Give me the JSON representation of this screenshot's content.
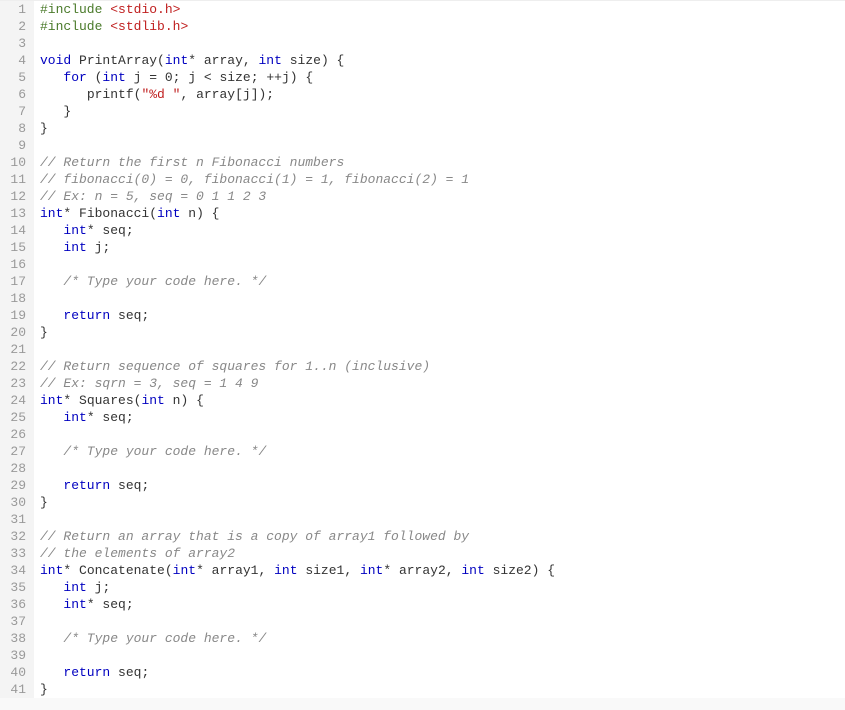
{
  "code_lines": [
    {
      "n": 1,
      "tokens": [
        {
          "c": "pp",
          "t": "#include"
        },
        {
          "c": "pn",
          "t": " "
        },
        {
          "c": "str",
          "t": "<stdio.h>"
        }
      ]
    },
    {
      "n": 2,
      "tokens": [
        {
          "c": "pp",
          "t": "#include"
        },
        {
          "c": "pn",
          "t": " "
        },
        {
          "c": "str",
          "t": "<stdlib.h>"
        }
      ]
    },
    {
      "n": 3,
      "tokens": []
    },
    {
      "n": 4,
      "tokens": [
        {
          "c": "ty",
          "t": "void"
        },
        {
          "c": "pn",
          "t": " "
        },
        {
          "c": "fn",
          "t": "PrintArray"
        },
        {
          "c": "pn",
          "t": "("
        },
        {
          "c": "ty",
          "t": "int"
        },
        {
          "c": "pn",
          "t": "* "
        },
        {
          "c": "id",
          "t": "array"
        },
        {
          "c": "pn",
          "t": ", "
        },
        {
          "c": "ty",
          "t": "int"
        },
        {
          "c": "pn",
          "t": " "
        },
        {
          "c": "id",
          "t": "size"
        },
        {
          "c": "pn",
          "t": ") {"
        }
      ]
    },
    {
      "n": 5,
      "tokens": [
        {
          "c": "pn",
          "t": "   "
        },
        {
          "c": "kw",
          "t": "for"
        },
        {
          "c": "pn",
          "t": " ("
        },
        {
          "c": "ty",
          "t": "int"
        },
        {
          "c": "pn",
          "t": " "
        },
        {
          "c": "id",
          "t": "j"
        },
        {
          "c": "pn",
          "t": " = "
        },
        {
          "c": "num",
          "t": "0"
        },
        {
          "c": "pn",
          "t": "; "
        },
        {
          "c": "id",
          "t": "j"
        },
        {
          "c": "pn",
          "t": " < "
        },
        {
          "c": "id",
          "t": "size"
        },
        {
          "c": "pn",
          "t": "; ++"
        },
        {
          "c": "id",
          "t": "j"
        },
        {
          "c": "pn",
          "t": ") {"
        }
      ]
    },
    {
      "n": 6,
      "tokens": [
        {
          "c": "pn",
          "t": "      "
        },
        {
          "c": "fn",
          "t": "printf"
        },
        {
          "c": "pn",
          "t": "("
        },
        {
          "c": "str",
          "t": "\"%d \""
        },
        {
          "c": "pn",
          "t": ", "
        },
        {
          "c": "id",
          "t": "array"
        },
        {
          "c": "pn",
          "t": "["
        },
        {
          "c": "id",
          "t": "j"
        },
        {
          "c": "pn",
          "t": "]);"
        }
      ]
    },
    {
      "n": 7,
      "tokens": [
        {
          "c": "pn",
          "t": "   }"
        }
      ]
    },
    {
      "n": 8,
      "tokens": [
        {
          "c": "pn",
          "t": "}"
        }
      ]
    },
    {
      "n": 9,
      "tokens": []
    },
    {
      "n": 10,
      "tokens": [
        {
          "c": "cm",
          "t": "// Return the first n Fibonacci numbers"
        }
      ]
    },
    {
      "n": 11,
      "tokens": [
        {
          "c": "cm",
          "t": "// fibonacci(0) = 0, fibonacci(1) = 1, fibonacci(2) = 1"
        }
      ]
    },
    {
      "n": 12,
      "tokens": [
        {
          "c": "cm",
          "t": "// Ex: n = 5, seq = 0 1 1 2 3"
        }
      ]
    },
    {
      "n": 13,
      "tokens": [
        {
          "c": "ty",
          "t": "int"
        },
        {
          "c": "pn",
          "t": "* "
        },
        {
          "c": "fn",
          "t": "Fibonacci"
        },
        {
          "c": "pn",
          "t": "("
        },
        {
          "c": "ty",
          "t": "int"
        },
        {
          "c": "pn",
          "t": " "
        },
        {
          "c": "id",
          "t": "n"
        },
        {
          "c": "pn",
          "t": ") {"
        }
      ]
    },
    {
      "n": 14,
      "tokens": [
        {
          "c": "pn",
          "t": "   "
        },
        {
          "c": "ty",
          "t": "int"
        },
        {
          "c": "pn",
          "t": "* "
        },
        {
          "c": "id",
          "t": "seq"
        },
        {
          "c": "pn",
          "t": ";"
        }
      ]
    },
    {
      "n": 15,
      "tokens": [
        {
          "c": "pn",
          "t": "   "
        },
        {
          "c": "ty",
          "t": "int"
        },
        {
          "c": "pn",
          "t": " "
        },
        {
          "c": "id",
          "t": "j"
        },
        {
          "c": "pn",
          "t": ";"
        }
      ]
    },
    {
      "n": 16,
      "tokens": []
    },
    {
      "n": 17,
      "tokens": [
        {
          "c": "pn",
          "t": "   "
        },
        {
          "c": "cm",
          "t": "/* Type your code here. */"
        }
      ]
    },
    {
      "n": 18,
      "tokens": []
    },
    {
      "n": 19,
      "tokens": [
        {
          "c": "pn",
          "t": "   "
        },
        {
          "c": "kw",
          "t": "return"
        },
        {
          "c": "pn",
          "t": " "
        },
        {
          "c": "id",
          "t": "seq"
        },
        {
          "c": "pn",
          "t": ";"
        }
      ]
    },
    {
      "n": 20,
      "tokens": [
        {
          "c": "pn",
          "t": "}"
        }
      ]
    },
    {
      "n": 21,
      "tokens": []
    },
    {
      "n": 22,
      "tokens": [
        {
          "c": "cm",
          "t": "// Return sequence of squares for 1..n (inclusive)"
        }
      ]
    },
    {
      "n": 23,
      "tokens": [
        {
          "c": "cm",
          "t": "// Ex: sqrn = 3, seq = 1 4 9"
        }
      ]
    },
    {
      "n": 24,
      "tokens": [
        {
          "c": "ty",
          "t": "int"
        },
        {
          "c": "pn",
          "t": "* "
        },
        {
          "c": "fn",
          "t": "Squares"
        },
        {
          "c": "pn",
          "t": "("
        },
        {
          "c": "ty",
          "t": "int"
        },
        {
          "c": "pn",
          "t": " "
        },
        {
          "c": "id",
          "t": "n"
        },
        {
          "c": "pn",
          "t": ") {"
        }
      ]
    },
    {
      "n": 25,
      "tokens": [
        {
          "c": "pn",
          "t": "   "
        },
        {
          "c": "ty",
          "t": "int"
        },
        {
          "c": "pn",
          "t": "* "
        },
        {
          "c": "id",
          "t": "seq"
        },
        {
          "c": "pn",
          "t": ";"
        }
      ]
    },
    {
      "n": 26,
      "tokens": []
    },
    {
      "n": 27,
      "tokens": [
        {
          "c": "pn",
          "t": "   "
        },
        {
          "c": "cm",
          "t": "/* Type your code here. */"
        }
      ]
    },
    {
      "n": 28,
      "tokens": []
    },
    {
      "n": 29,
      "tokens": [
        {
          "c": "pn",
          "t": "   "
        },
        {
          "c": "kw",
          "t": "return"
        },
        {
          "c": "pn",
          "t": " "
        },
        {
          "c": "id",
          "t": "seq"
        },
        {
          "c": "pn",
          "t": ";"
        }
      ]
    },
    {
      "n": 30,
      "tokens": [
        {
          "c": "pn",
          "t": "}"
        }
      ]
    },
    {
      "n": 31,
      "tokens": []
    },
    {
      "n": 32,
      "tokens": [
        {
          "c": "cm",
          "t": "// Return an array that is a copy of array1 followed by"
        }
      ]
    },
    {
      "n": 33,
      "tokens": [
        {
          "c": "cm",
          "t": "// the elements of array2"
        }
      ]
    },
    {
      "n": 34,
      "tokens": [
        {
          "c": "ty",
          "t": "int"
        },
        {
          "c": "pn",
          "t": "* "
        },
        {
          "c": "fn",
          "t": "Concatenate"
        },
        {
          "c": "pn",
          "t": "("
        },
        {
          "c": "ty",
          "t": "int"
        },
        {
          "c": "pn",
          "t": "* "
        },
        {
          "c": "id",
          "t": "array1"
        },
        {
          "c": "pn",
          "t": ", "
        },
        {
          "c": "ty",
          "t": "int"
        },
        {
          "c": "pn",
          "t": " "
        },
        {
          "c": "id",
          "t": "size1"
        },
        {
          "c": "pn",
          "t": ", "
        },
        {
          "c": "ty",
          "t": "int"
        },
        {
          "c": "pn",
          "t": "* "
        },
        {
          "c": "id",
          "t": "array2"
        },
        {
          "c": "pn",
          "t": ", "
        },
        {
          "c": "ty",
          "t": "int"
        },
        {
          "c": "pn",
          "t": " "
        },
        {
          "c": "id",
          "t": "size2"
        },
        {
          "c": "pn",
          "t": ") {"
        }
      ]
    },
    {
      "n": 35,
      "tokens": [
        {
          "c": "pn",
          "t": "   "
        },
        {
          "c": "ty",
          "t": "int"
        },
        {
          "c": "pn",
          "t": " "
        },
        {
          "c": "id",
          "t": "j"
        },
        {
          "c": "pn",
          "t": ";"
        }
      ]
    },
    {
      "n": 36,
      "tokens": [
        {
          "c": "pn",
          "t": "   "
        },
        {
          "c": "ty",
          "t": "int"
        },
        {
          "c": "pn",
          "t": "* "
        },
        {
          "c": "id",
          "t": "seq"
        },
        {
          "c": "pn",
          "t": ";"
        }
      ]
    },
    {
      "n": 37,
      "tokens": []
    },
    {
      "n": 38,
      "tokens": [
        {
          "c": "pn",
          "t": "   "
        },
        {
          "c": "cm",
          "t": "/* Type your code here. */"
        }
      ]
    },
    {
      "n": 39,
      "tokens": []
    },
    {
      "n": 40,
      "tokens": [
        {
          "c": "pn",
          "t": "   "
        },
        {
          "c": "kw",
          "t": "return"
        },
        {
          "c": "pn",
          "t": " "
        },
        {
          "c": "id",
          "t": "seq"
        },
        {
          "c": "pn",
          "t": ";"
        }
      ]
    },
    {
      "n": 41,
      "tokens": [
        {
          "c": "pn",
          "t": "}"
        }
      ]
    }
  ]
}
